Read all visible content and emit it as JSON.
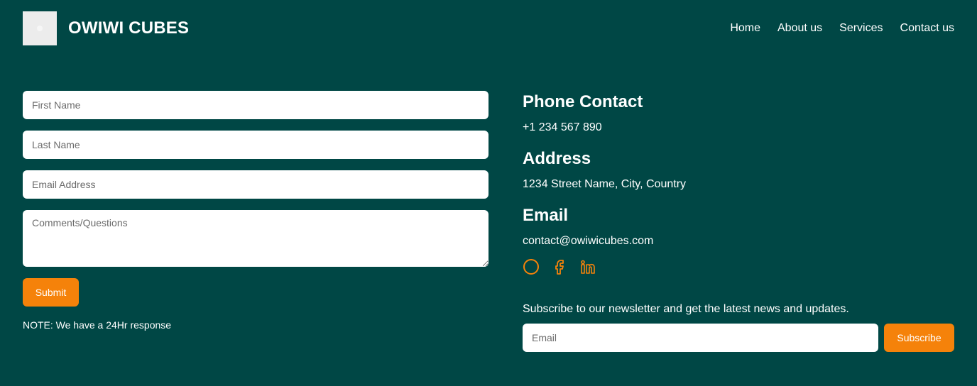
{
  "brand": {
    "name": "OWIWI CUBES"
  },
  "nav": {
    "items": [
      "Home",
      "About us",
      "Services",
      "Contact us"
    ]
  },
  "form": {
    "first_name_placeholder": "First Name",
    "last_name_placeholder": "Last Name",
    "email_placeholder": "Email Address",
    "comments_placeholder": "Comments/Questions",
    "submit_label": "Submit",
    "note": "NOTE: We have a 24Hr response"
  },
  "contact": {
    "phone_heading": "Phone Contact",
    "phone": "+1 234 567 890",
    "address_heading": "Address",
    "address": "1234 Street Name, City, Country",
    "email_heading": "Email",
    "email": "contact@owiwicubes.com",
    "socials": [
      "circle-icon",
      "facebook-icon",
      "linkedin-icon"
    ]
  },
  "newsletter": {
    "text": "Subscribe to our newsletter and get the latest news and updates.",
    "email_placeholder": "Email",
    "subscribe_label": "Subscribe"
  },
  "colors": {
    "background": "#004745",
    "accent": "#f5820a",
    "text": "#ffffff"
  }
}
